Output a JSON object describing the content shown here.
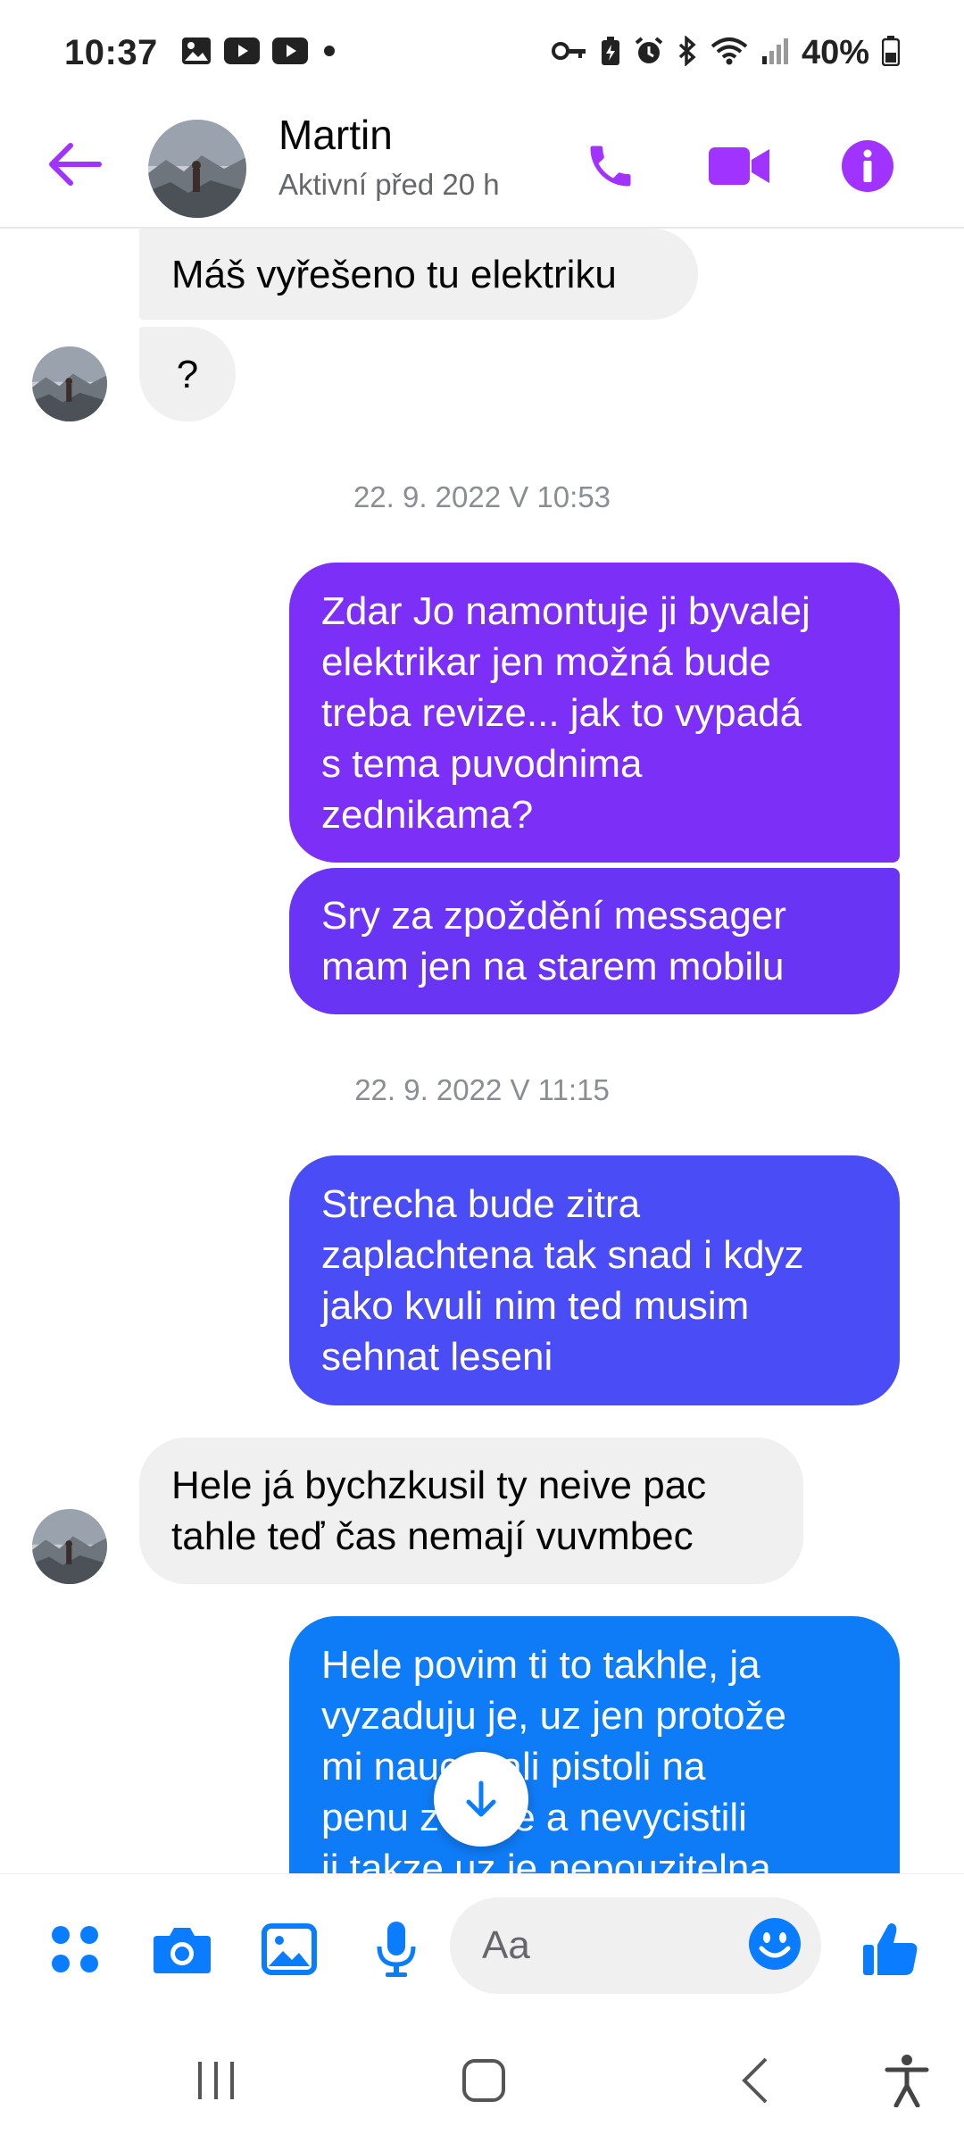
{
  "status_bar": {
    "time": "10:37",
    "battery": "40%",
    "icons_left": [
      "gallery-icon",
      "youtube-icon",
      "youtube-icon",
      "dot-icon"
    ],
    "icons_right": [
      "vpn-key-icon",
      "battery-saver-icon",
      "alarm-icon",
      "bluetooth-icon",
      "wifi-icon",
      "signal-icon",
      "battery-icon"
    ]
  },
  "header": {
    "name": "Martin",
    "status": "Aktivní před 20 h",
    "accent": "#a033ff"
  },
  "messages": [
    {
      "dir": "in",
      "text": "Máš vyřešeno tu elektriku"
    },
    {
      "dir": "in",
      "text": "?"
    },
    {
      "type": "timestamp",
      "text": "22. 9. 2022 V 10:53"
    },
    {
      "dir": "out",
      "color": "#7b2ff7",
      "text": "Zdar Jo namontuje ji byvalej\nelektrikar jen možná bude\ntreba revize... jak to vypadá\ns tema puvodnima\nzednikama?"
    },
    {
      "dir": "out",
      "color": "#6a34f5",
      "text": "Sry za zpoždění messager\nmam jen na starem mobilu"
    },
    {
      "type": "timestamp",
      "text": "22. 9. 2022 V 11:15"
    },
    {
      "dir": "out",
      "color": "#4a4cf6",
      "text": "Strecha bude zitra\nzaplachtena tak snad i kdyz\njako kvuli nim ted musim\nsehnat leseni"
    },
    {
      "dir": "in",
      "text": "Hele já bychzkusil ty neive pac\ntahle teď čas nemají vuvmbec"
    },
    {
      "dir": "out",
      "color": "#0f7cf7",
      "text": "Hele povim ti to takhle, ja\nvyzaduju je, uz jen protože\nmi naucovali pistoli na\npenu z moje a nevycistili\nji takze uz je nepouzitelna"
    }
  ],
  "composer": {
    "placeholder": "Aa",
    "accent": "#0a7cff"
  },
  "navbar": {
    "buttons": [
      "recent-apps",
      "home",
      "back",
      "accessibility"
    ]
  }
}
